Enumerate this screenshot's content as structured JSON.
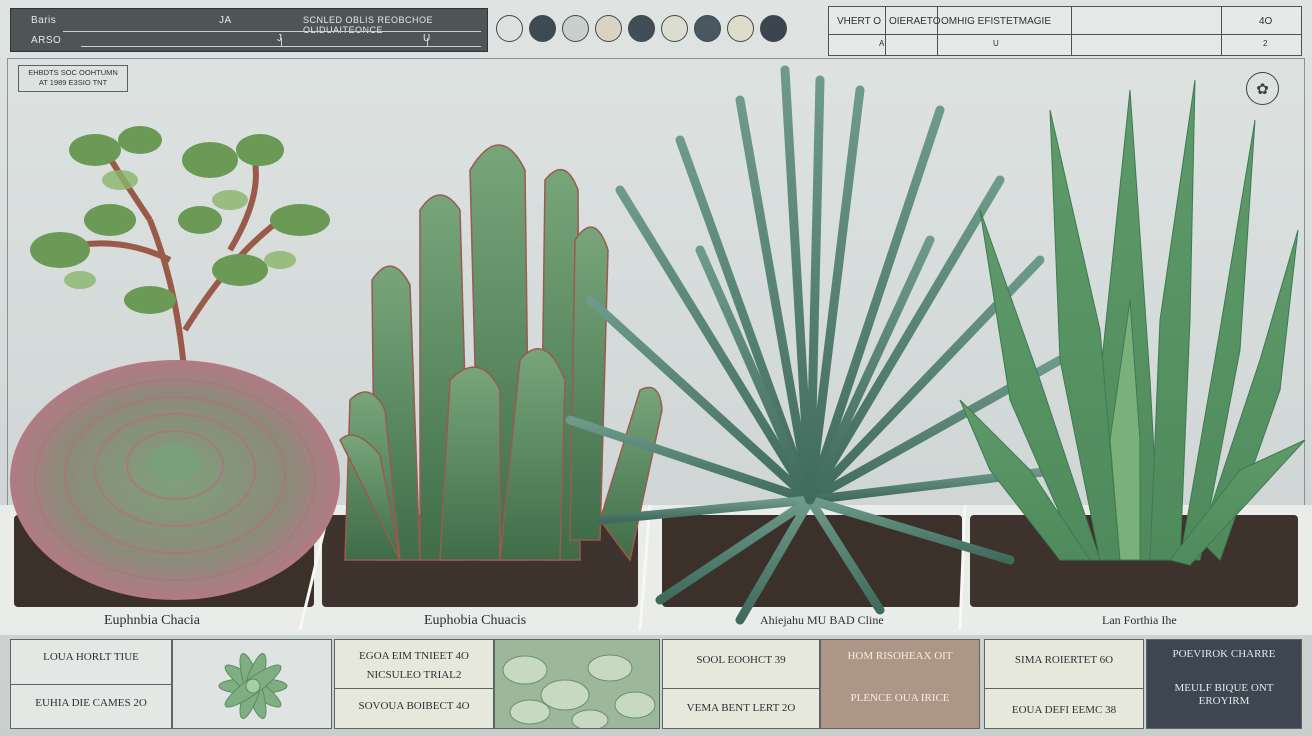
{
  "header_left": {
    "row1_label": "Baris",
    "row1_mid": "JA",
    "row1_right": "SCNLED OBLIS REOBCHOE OLIDUAITEONCE",
    "row2_label": "ARSO",
    "row2_mid": "J",
    "row2_right": "U"
  },
  "swatches": [
    "#dde1df",
    "#3e4a52",
    "#c9cfcc",
    "#d8d3c2",
    "#414e58",
    "#dcdcd0",
    "#4a5660",
    "#deddcc",
    "#3c4450"
  ],
  "header_right": {
    "c1": "VHERT O",
    "c2": "OIERAETO",
    "c3": "OMHIG EFISTETMAGIE",
    "c4": "4O",
    "r2a": "A",
    "r2b": "U",
    "r2c": "2"
  },
  "note": {
    "line1": "EHBDTS SOC OOHTUMN",
    "line2": "AT 1989 E3SIO TNT"
  },
  "badge_icon": "leaf-emblem-icon",
  "plant_labels": [
    "Euphnbia Chacia",
    "Euphobia Chuacis",
    "Ahiejahu MU BAD Cline",
    "Lan Forthia Ihe"
  ],
  "panels": {
    "p1": {
      "top": "LOUA HORLT TIUE",
      "bottom": "EUHIA DIE CAMES 2O"
    },
    "p3": {
      "top": "EGOA EIM TNIEET 4O",
      "mid": "NICSULEO TRIAL2",
      "bottom": "SOVOUA BOIBECT 4O"
    },
    "p5": {
      "top": "SOOL EOOHCT 39",
      "bottom": "VEMA BENT LERT 2O"
    },
    "p6": {
      "top": "HOM RISOHEAX OIT",
      "bottom": "PLENCE OUA IRICE"
    },
    "p7": {
      "top": "SIMA ROIERTET 6O",
      "bottom": "EOUA DEFI EEMC 38"
    },
    "p8": {
      "top": "POEVIROK CHARRE",
      "bottom": "MEULF BIQUE ONT EROYIRM"
    }
  },
  "colors": {
    "panel_tan": "#ad9686",
    "panel_navy": "#3e4651",
    "panel_cream": "#e7e8dc"
  }
}
